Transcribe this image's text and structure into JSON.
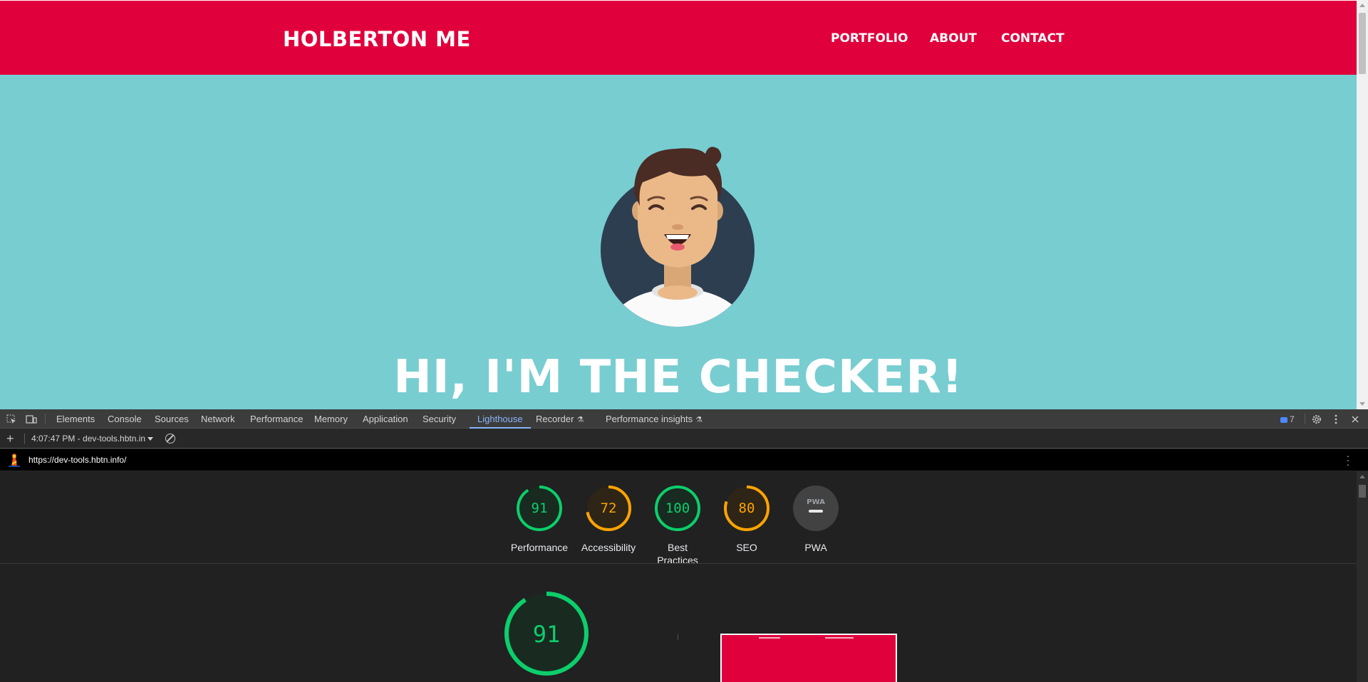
{
  "site": {
    "logo": "HOLBERTON ME",
    "nav": [
      "PORTFOLIO",
      "ABOUT",
      "CONTACT"
    ],
    "hero_title": "HI, I'M THE CHECKER!",
    "colors": {
      "header": "#e0003c",
      "hero_bg": "#78cdd1",
      "text": "#ffffff"
    }
  },
  "devtools": {
    "tabs": [
      "Elements",
      "Console",
      "Sources",
      "Network",
      "Performance",
      "Memory",
      "Application",
      "Security",
      "Lighthouse",
      "Recorder",
      "Performance insights"
    ],
    "active_tab": "Lighthouse",
    "experimental_tabs": [
      "Recorder",
      "Performance insights"
    ],
    "issues_count": "7",
    "icons": [
      "inspect-element-icon",
      "device-toolbar-icon",
      "settings-icon",
      "more-options-icon",
      "close-icon"
    ]
  },
  "lighthouse": {
    "report_select": "4:07:47 PM - dev-tools.hbtn.in",
    "url": "https://dev-tools.hbtn.info/",
    "categories": [
      {
        "label": "Performance",
        "score": 91,
        "color": "#0cce6b"
      },
      {
        "label": "Accessibility",
        "score": 72,
        "color": "#ffa400"
      },
      {
        "label": "Best Practices",
        "score": 100,
        "color": "#0cce6b"
      },
      {
        "label": "SEO",
        "score": 80,
        "color": "#ffa400"
      },
      {
        "label": "PWA",
        "score": null,
        "badge": "PWA",
        "color": "#9aa0a6"
      }
    ],
    "main_gauge_score": "91"
  }
}
